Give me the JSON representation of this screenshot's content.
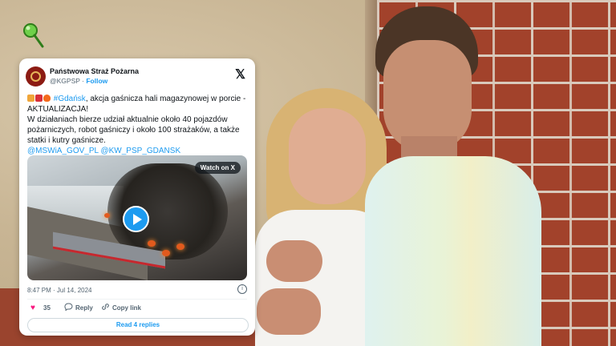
{
  "tweet": {
    "author_name": "Państwowa Straż Pożarna",
    "author_handle": "@KGPSP",
    "separator": "·",
    "follow_label": "Follow",
    "x_logo": "𝕏",
    "line1_hashtag": "#Gdańsk",
    "line1_rest": ", akcja gaśnicza hali magazynowej w porcie - AKTUALIZACJA!",
    "line2": "W działaniach bierze udział aktualnie około 40 pojazdów pożarniczych, robot gaśniczy i około 100 strażaków, a także statki i kutry gaśnicze.",
    "mention1": "@MSWiA_GOV_PL",
    "mention2": "@KW_PSP_GDANSK",
    "watch_label": "Watch on X",
    "timestamp": "8:47 PM · Jul 14, 2024",
    "info_icon": "i",
    "likes_count": "35",
    "reply_label": "Reply",
    "copy_link_label": "Copy link",
    "read_replies_label": "Read 4 replies"
  },
  "icons": {
    "heart": "♥",
    "reply": "💬",
    "copy": "🔗"
  },
  "colors": {
    "link": "#1d9bf0",
    "heart": "#f91880",
    "avatar": "#8c1b13",
    "pin": "#6fd04a"
  }
}
